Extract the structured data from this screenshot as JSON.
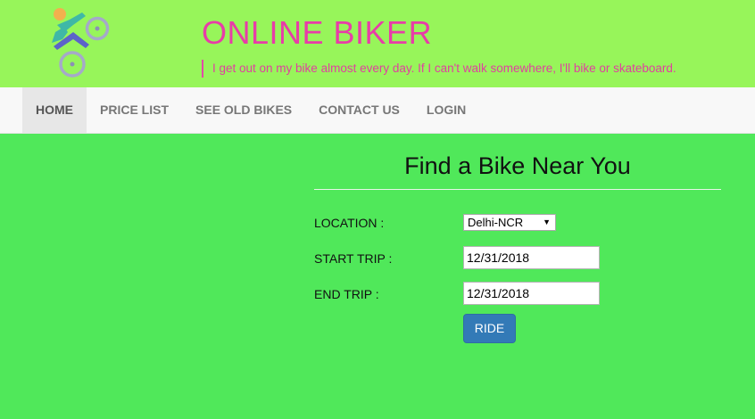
{
  "header": {
    "site_title": "ONLINE BIKER",
    "tagline": "I get out on my bike almost every day. If I can't walk somewhere, I'll bike or skateboard.",
    "logo_icon": "bicycle-rider-icon"
  },
  "nav": {
    "items": [
      {
        "label": "HOME",
        "active": true
      },
      {
        "label": "PRICE LIST",
        "active": false
      },
      {
        "label": "SEE OLD BIKES",
        "active": false
      },
      {
        "label": "CONTACT US",
        "active": false
      },
      {
        "label": "LOGIN",
        "active": false
      }
    ]
  },
  "form": {
    "title": "Find a Bike Near You",
    "location_label": "LOCATION :",
    "location_value": "Delhi-NCR",
    "start_label": "START TRIP :",
    "start_value": "12/31/2018",
    "end_label": "END TRIP :",
    "end_value": "12/31/2018",
    "submit_label": "RIDE"
  },
  "colors": {
    "header_bg": "#97f55a",
    "page_bg": "#50e85a",
    "title_color": "#e83ca8",
    "button_bg": "#337ab7"
  }
}
